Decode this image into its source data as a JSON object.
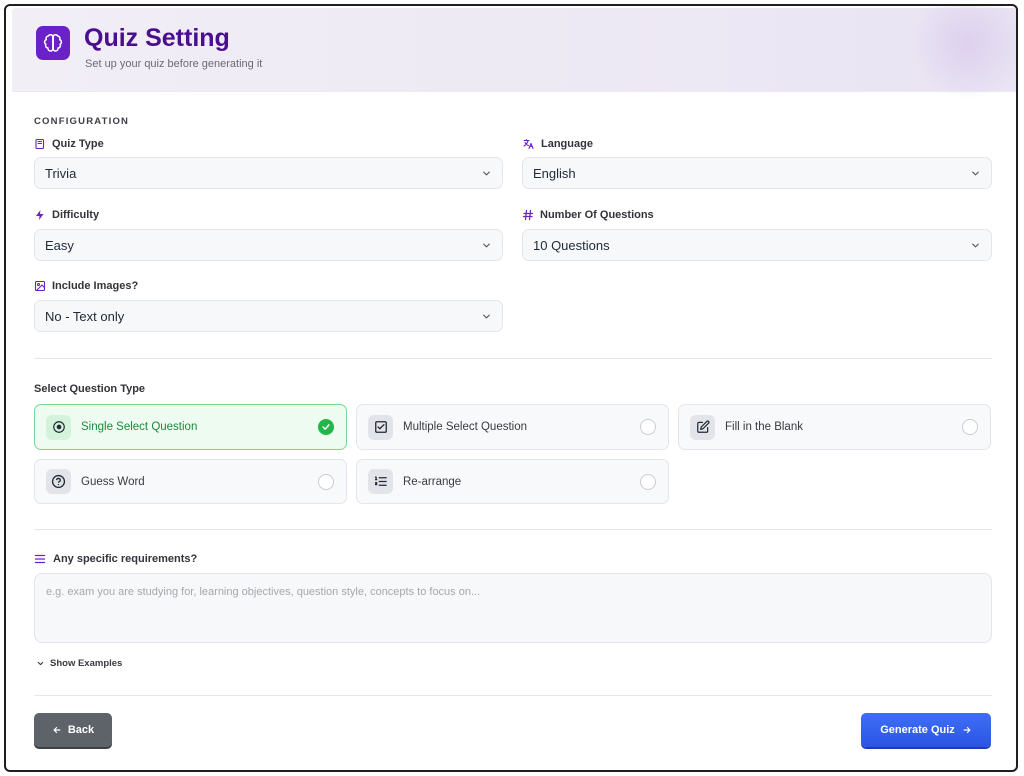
{
  "header": {
    "title": "Quiz Setting",
    "subtitle": "Set up your quiz before generating it"
  },
  "configuration": {
    "section_label": "CONFIGURATION",
    "quiz_type": {
      "label": "Quiz Type",
      "value": "Trivia"
    },
    "language": {
      "label": "Language",
      "value": "English"
    },
    "difficulty": {
      "label": "Difficulty",
      "value": "Easy"
    },
    "number_of_questions": {
      "label": "Number Of Questions",
      "value": "10 Questions"
    },
    "include_images": {
      "label": "Include Images?",
      "value": "No - Text only"
    }
  },
  "question_types": {
    "heading": "Select Question Type",
    "items": [
      {
        "label": "Single Select Question",
        "icon": "target-icon",
        "selected": true
      },
      {
        "label": "Multiple Select Question",
        "icon": "checkbox-icon",
        "selected": false
      },
      {
        "label": "Fill in the Blank",
        "icon": "edit-icon",
        "selected": false
      },
      {
        "label": "Guess Word",
        "icon": "question-icon",
        "selected": false
      },
      {
        "label": "Re-arrange",
        "icon": "list-ordered-icon",
        "selected": false
      }
    ]
  },
  "requirements": {
    "label": "Any specific requirements?",
    "placeholder": "e.g. exam you are studying for, learning objectives, question style, concepts to focus on...",
    "value": "",
    "show_examples_label": "Show Examples"
  },
  "footer": {
    "back_label": "Back",
    "generate_label": "Generate Quiz"
  },
  "colors": {
    "brand": "#6b21c8",
    "title": "#4a0e8f",
    "selected_green": "#22b54c",
    "primary_blue": "#2a54e6",
    "back_gray": "#5e6369"
  }
}
